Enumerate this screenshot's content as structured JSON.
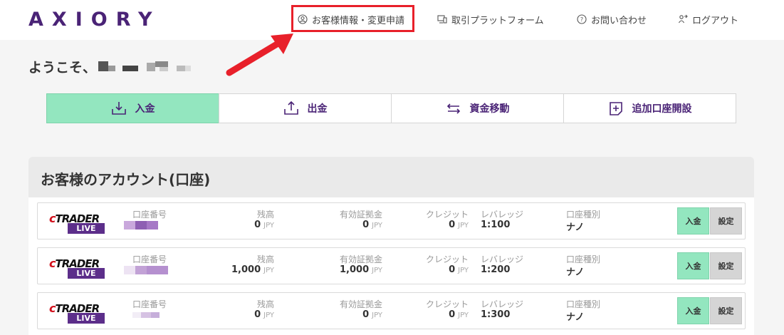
{
  "header": {
    "logo": "AXIORY",
    "nav": [
      {
        "label": "お客様情報・変更申請",
        "icon": "user-circle-icon"
      },
      {
        "label": "取引プラットフォーム",
        "icon": "monitor-icon"
      },
      {
        "label": "お問い合わせ",
        "icon": "question-circle-icon"
      },
      {
        "label": "ログアウト",
        "icon": "logout-icon"
      }
    ]
  },
  "welcome": {
    "text": "ようこそ、"
  },
  "actions": [
    {
      "label": "入金",
      "icon": "download-tray-icon"
    },
    {
      "label": "出金",
      "icon": "upload-tray-icon"
    },
    {
      "label": "資金移動",
      "icon": "transfer-arrows-icon"
    },
    {
      "label": "追加口座開設",
      "icon": "add-document-icon"
    }
  ],
  "accounts": {
    "title": "お客様のアカウント(口座)",
    "labels": {
      "number": "口座番号",
      "balance": "残高",
      "margin": "有効証拠金",
      "credit": "クレジット",
      "leverage": "レバレッジ",
      "type": "口座種別",
      "unit": "JPY",
      "deposit_button": "入金",
      "settings_button": "設定"
    },
    "platform": {
      "logo_c": "c",
      "logo_rest": "TRADER",
      "badge": "LIVE"
    },
    "rows": [
      {
        "balance": "0",
        "margin": "0",
        "credit": "0",
        "leverage": "1:100",
        "type": "ナノ"
      },
      {
        "balance": "1,000",
        "margin": "1,000",
        "credit": "0",
        "leverage": "1:200",
        "type": "ナノ"
      },
      {
        "balance": "0",
        "margin": "0",
        "credit": "0",
        "leverage": "1:300",
        "type": "ナノ"
      }
    ]
  },
  "colors": {
    "brand": "#4a2376",
    "accent_green": "#93e6bf",
    "highlight_red": "#e8202a"
  }
}
